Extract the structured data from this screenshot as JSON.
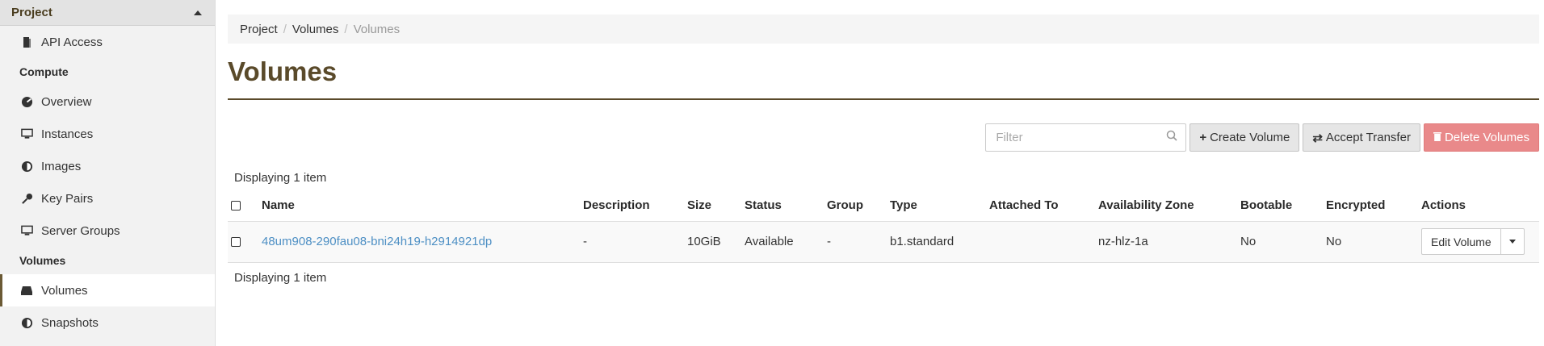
{
  "sidebar": {
    "header": "Project",
    "items": [
      {
        "label": "API Access",
        "icon": "book-icon"
      },
      {
        "group": "Compute"
      },
      {
        "label": "Overview",
        "icon": "dashboard-icon"
      },
      {
        "label": "Instances",
        "icon": "monitor-icon"
      },
      {
        "label": "Images",
        "icon": "disc-icon"
      },
      {
        "label": "Key Pairs",
        "icon": "key-icon"
      },
      {
        "label": "Server Groups",
        "icon": "monitor-icon"
      },
      {
        "group": "Volumes"
      },
      {
        "label": "Volumes",
        "icon": "hdd-icon",
        "active": true
      },
      {
        "label": "Snapshots",
        "icon": "disc-icon"
      }
    ]
  },
  "breadcrumb": [
    "Project",
    "Volumes",
    "Volumes"
  ],
  "page_title": "Volumes",
  "filter": {
    "placeholder": "Filter"
  },
  "buttons": {
    "create": "Create Volume",
    "accept": "Accept Transfer",
    "delete": "Delete Volumes"
  },
  "display_count": "Displaying 1 item",
  "table": {
    "columns": [
      "Name",
      "Description",
      "Size",
      "Status",
      "Group",
      "Type",
      "Attached To",
      "Availability Zone",
      "Bootable",
      "Encrypted",
      "Actions"
    ],
    "rows": [
      {
        "name": "48um908-290fau08-bni24h19-h2914921dp",
        "description": "-",
        "size": "10GiB",
        "status": "Available",
        "group": "-",
        "type": "b1.standard",
        "attached_to": "",
        "availability_zone": "nz-hlz-1a",
        "bootable": "No",
        "encrypted": "No",
        "action": "Edit Volume"
      }
    ]
  },
  "colors": {
    "accent": "#5a4a2a",
    "link": "#4d8fc4",
    "danger": "#e9898a"
  }
}
